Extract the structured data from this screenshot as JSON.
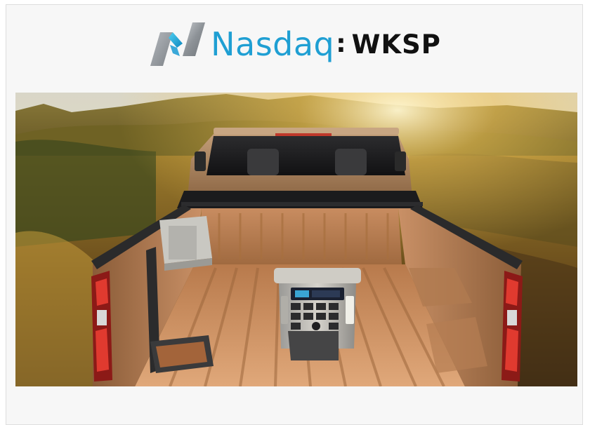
{
  "header": {
    "brand_text": "Nasdaq",
    "separator": ":",
    "ticker": "WKSP"
  },
  "colors": {
    "brand_blue": "#1f9fd3",
    "ticker_black": "#111111",
    "card_background": "#f7f7f7",
    "bed_copper": "#c98d5f"
  },
  "icons": {
    "logo": "nasdaq-logo-mark"
  }
}
